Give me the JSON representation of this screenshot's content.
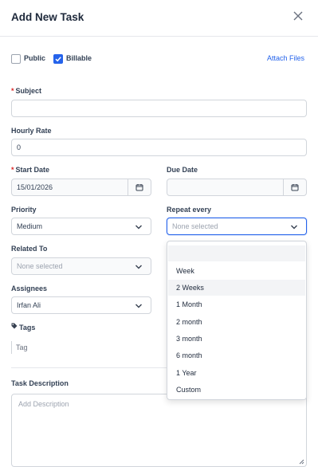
{
  "modal": {
    "title": "Add New Task",
    "close_icon": "close-icon"
  },
  "options": {
    "public_label": "Public",
    "public_checked": false,
    "billable_label": "Billable",
    "billable_checked": true,
    "attach_files": "Attach Files"
  },
  "form": {
    "subject_label": "Subject",
    "subject_value": "",
    "hourly_rate_label": "Hourly Rate",
    "hourly_rate_value": "0",
    "start_date_label": "Start Date",
    "start_date_value": "15/01/2026",
    "due_date_label": "Due Date",
    "due_date_value": "",
    "priority_label": "Priority",
    "priority_value": "Medium",
    "repeat_label": "Repeat every",
    "repeat_value": "None selected",
    "related_label": "Related To",
    "related_value": "None selected",
    "assignees_label": "Assignees",
    "assignees_value": "Irfan Ali",
    "tags_label": "Tags",
    "tags_placeholder": "Tag",
    "description_label": "Task Description",
    "description_placeholder": "Add Description"
  },
  "repeat_dropdown": {
    "items": [
      "Week",
      "2 Weeks",
      "1 Month",
      "2 month",
      "3 month",
      "6 month",
      "1 Year",
      "Custom"
    ],
    "highlighted": "2 Weeks"
  },
  "colors": {
    "accent": "#2563eb",
    "required": "#dc2626"
  }
}
